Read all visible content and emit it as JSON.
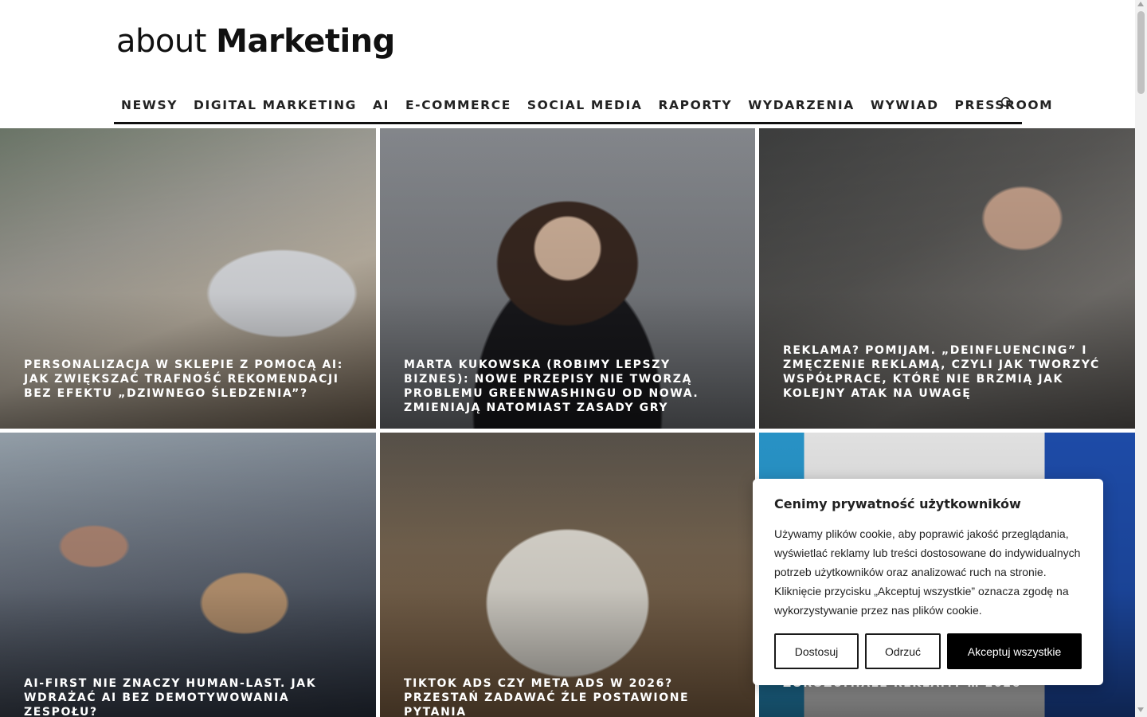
{
  "site": {
    "logo_light": "about",
    "logo_bold": "Marketing"
  },
  "nav": {
    "items": [
      "NEWSY",
      "DIGITAL MARKETING",
      "AI",
      "E-COMMERCE",
      "SOCIAL MEDIA",
      "RAPORTY",
      "WYDARZENIA",
      "WYWIAD",
      "PRESSROOM"
    ],
    "search_icon": "search-icon"
  },
  "articles": [
    {
      "title": "Personalizacja w sklepie z pomocą AI: jak zwiększać trafność rekomendacji bez efektu „dziwnego śledzenia”?"
    },
    {
      "title": "Marta Kukowska (Robimy Lepszy Biznes): Nowe przepisy nie tworzą problemu greenwashingu od nowa. Zmieniają natomiast zasady gry"
    },
    {
      "title": "Reklama? Pomijam. „Deinfluencing” i zmęczenie reklamą, czyli jak tworzyć współprace, które nie brzmią jak kolejny atak na uwagę"
    },
    {
      "title": "AI-first nie znaczy human-last. Jak wdrażać AI bez demotywowania zespołu?"
    },
    {
      "title": "TikTok Ads czy Meta Ads w 2026? Przestań zadawać źle postawione pytania"
    },
    {
      "title": "zorozumiałe reklamy … 2026"
    }
  ],
  "cookie": {
    "title": "Cenimy prywatność użytkowników",
    "text": "Używamy plików cookie, aby poprawić jakość przeglądania, wyświetlać reklamy lub treści dostosowane do indywidualnych potrzeb użytkowników oraz analizować ruch na stronie. Kliknięcie przycisku „Akceptuj wszystkie” oznacza zgodę na wykorzystywanie przez nas plików cookie.",
    "customize": "Dostosuj",
    "reject": "Odrzuć",
    "accept": "Akceptuj wszystkie"
  }
}
